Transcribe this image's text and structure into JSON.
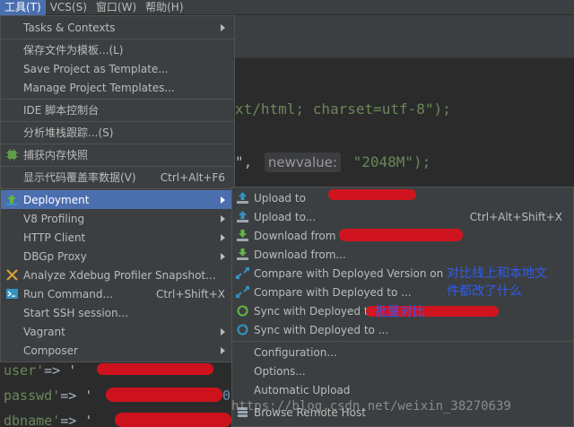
{
  "menubar": {
    "items": [
      {
        "label": "工具(T)",
        "active": true
      },
      {
        "label": "VCS(S)",
        "active": false
      },
      {
        "label": "窗口(W)",
        "active": false
      },
      {
        "label": "帮助(H)",
        "active": false
      }
    ]
  },
  "editor": {
    "line1": "xt/html; charset=utf-8\");",
    "line2_pre": "\",",
    "line2_hint": "newvalue:",
    "line2_str": "\"2048M\");",
    "left_lines": [
      {
        "key": "user'",
        "arrow": "=> '"
      },
      {
        "key": "passwd'",
        "arrow": "=> '"
      },
      {
        "key": "dbname'",
        "arrow": "=> '"
      }
    ],
    "line_passwd_tail": "0"
  },
  "tools_menu": {
    "items": [
      {
        "label": "Tasks & Contexts",
        "submenu": true
      },
      {
        "label": "保存文件为模板...(L)"
      },
      {
        "label": "Save Project as Template..."
      },
      {
        "label": "Manage Project Templates..."
      },
      {
        "label": "IDE 脚本控制台"
      },
      {
        "label": "分析堆栈跟踪...(S)"
      },
      {
        "label": "捕获内存快照"
      },
      {
        "label": "显示代码覆盖率数据(V)",
        "shortcut": "Ctrl+Alt+F6"
      },
      {
        "label": "Deployment",
        "submenu": true,
        "selected": true
      },
      {
        "label": "V8 Profiling",
        "submenu": true
      },
      {
        "label": "HTTP Client",
        "submenu": true
      },
      {
        "label": "DBGp Proxy",
        "submenu": true
      },
      {
        "label": "Analyze Xdebug Profiler Snapshot..."
      },
      {
        "label": "Run Command...",
        "shortcut": "Ctrl+Shift+X"
      },
      {
        "label": "Start SSH session..."
      },
      {
        "label": "Vagrant",
        "submenu": true
      },
      {
        "label": "Composer",
        "submenu": true
      }
    ]
  },
  "deployment_menu": {
    "items": [
      {
        "label": "Upload to ",
        "icon": "upload-icon"
      },
      {
        "label": "Upload to...",
        "shortcut": "Ctrl+Alt+Shift+X",
        "icon": "upload-icon"
      },
      {
        "label": "Download from ",
        "icon": "download-icon"
      },
      {
        "label": "Download from...",
        "icon": "download-icon"
      },
      {
        "label": "Compare with Deployed Version on ",
        "icon": "compare-icon"
      },
      {
        "label": "Compare with Deployed to ...",
        "icon": "compare-icon"
      },
      {
        "label": "Sync with Deployed to ",
        "icon": "sync-icon"
      },
      {
        "label": "Sync with Deployed to ...",
        "icon": "sync-icon"
      },
      {
        "label": "Configuration..."
      },
      {
        "label": "Options..."
      },
      {
        "label": "Automatic Upload"
      },
      {
        "label": "Browse Remote Host",
        "icon": "remote-host-icon"
      }
    ]
  },
  "annotations": {
    "note1": "对比线上和本地文",
    "note2": "件都改了什么",
    "note3": "批量对比"
  },
  "watermark": "https://blog.csdn.net/weixin_38270639",
  "colors": {
    "menu_bg": "#3c3f41",
    "selection": "#4b6eaf",
    "editor_bg": "#2b2b2b",
    "redaction": "#e0101c",
    "annotation": "#2e5cf0"
  }
}
